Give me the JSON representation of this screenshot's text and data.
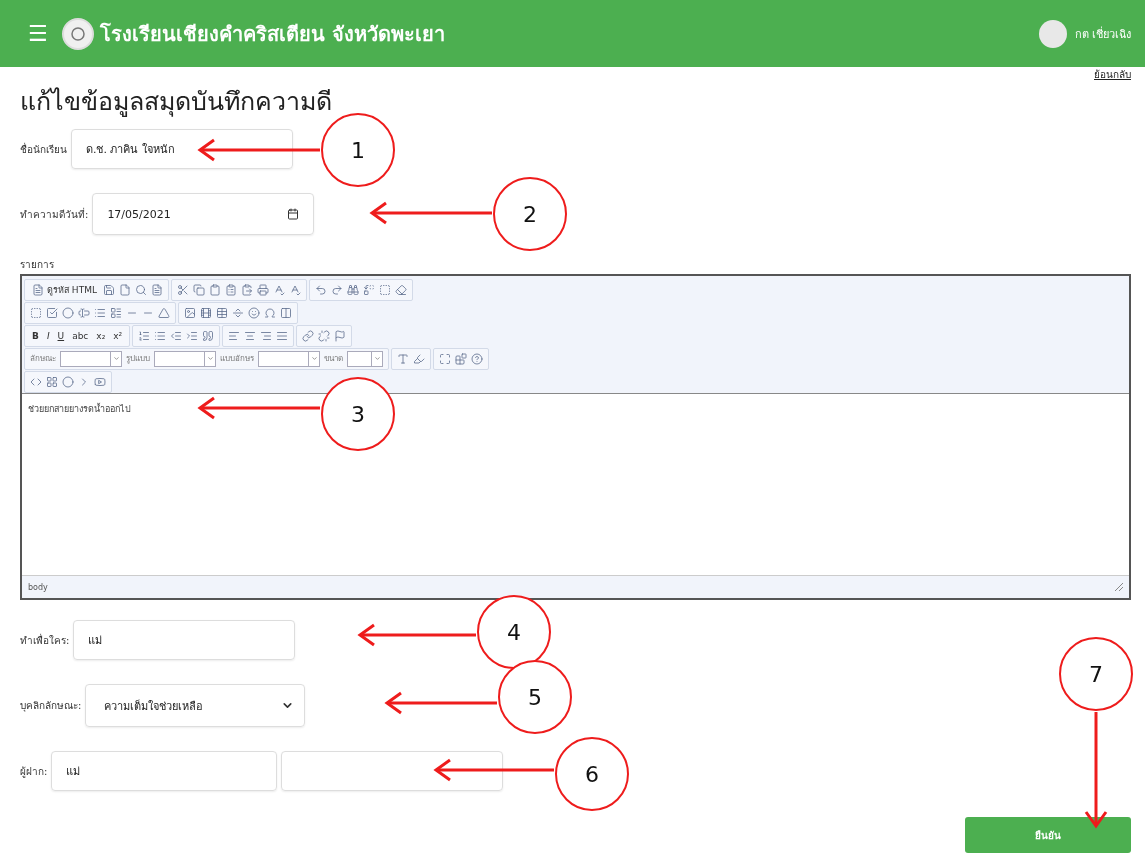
{
  "header": {
    "menu_icon": "☰",
    "school_name": "โรงเรียนเชียงคำคริสเตียน จังหวัดพะเยา",
    "user_name": "กต เชี่ยวเฉิง"
  },
  "back_link": "ย้อนกลับ",
  "title": "แก้ไขข้อมูลสมุดบันทึกความดี",
  "student_field": {
    "label": "ชื่อนักเรียน",
    "value": "ด.ช. ภาคิน ใจหนัก"
  },
  "date_field": {
    "label": "ทำความดีวันที่:",
    "value": "17/05/2021"
  },
  "editor": {
    "label": "รายการ",
    "source_label": "ดูรหัส HTML",
    "format_buttons": [
      "B",
      "I",
      "U",
      "abc",
      "x₂",
      "x²"
    ],
    "combos": [
      {
        "label": "ลักษณะ"
      },
      {
        "label": "รูปแบบ"
      },
      {
        "label": "แบบอักษร"
      },
      {
        "label": "ขนาด"
      }
    ],
    "content": "ช่วยยกสายยางรดน้ำออกไป",
    "status_path": "body"
  },
  "for_whom_field": {
    "label": "ทำเพื่อใคร:",
    "value": "แม่"
  },
  "trait_select": {
    "label": "บุคลิกลักษณะ:",
    "value": "ความเต็มใจช่วยเหลือ"
  },
  "depositor_field": {
    "label": "ผู้ฝาก:",
    "value": "แม่"
  },
  "submit_button": "ยืนยัน",
  "callouts": [
    "1",
    "2",
    "3",
    "4",
    "5",
    "6",
    "7"
  ]
}
